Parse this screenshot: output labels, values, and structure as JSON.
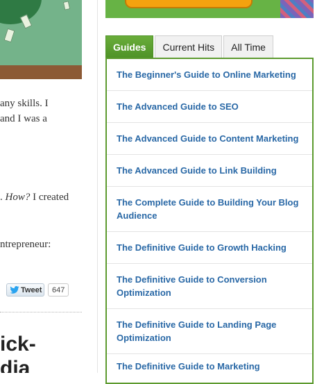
{
  "article": {
    "fragments": [
      {
        "text": "any skills. I",
        "emphasis": ""
      },
      {
        "text": "and I was a",
        "emphasis": ""
      },
      {
        "text": ". ",
        "emphasis": "How?",
        "after": " I created"
      },
      {
        "text": "ntrepreneur:",
        "emphasis": ""
      }
    ],
    "heading_lines": [
      "ick-",
      "dia"
    ]
  },
  "share": {
    "tweet_label": "Tweet",
    "tweet_count": "647"
  },
  "sidebar": {
    "tabs": [
      {
        "label": "Guides",
        "active": true
      },
      {
        "label": "Current Hits",
        "active": false
      },
      {
        "label": "All Time",
        "active": false
      }
    ],
    "guides": [
      "The Beginner's Guide to Online Marketing",
      "The Advanced Guide to SEO",
      "The Advanced Guide to Content Marketing",
      "The Advanced Guide to Link Building",
      "The Complete Guide to Building Your Blog Audience",
      "The Definitive Guide to Growth Hacking",
      "The Definitive Guide to Conversion Optimization",
      "The Definitive Guide to Landing Page Optimization",
      "The Definitive Guide to Marketing"
    ]
  },
  "colors": {
    "accent_green": "#5c9a2e",
    "link_blue": "#2968a6",
    "banner_green": "#67b345",
    "banner_orange": "#f5a20f"
  },
  "icons": {
    "tweet": "twitter-bird-icon"
  }
}
